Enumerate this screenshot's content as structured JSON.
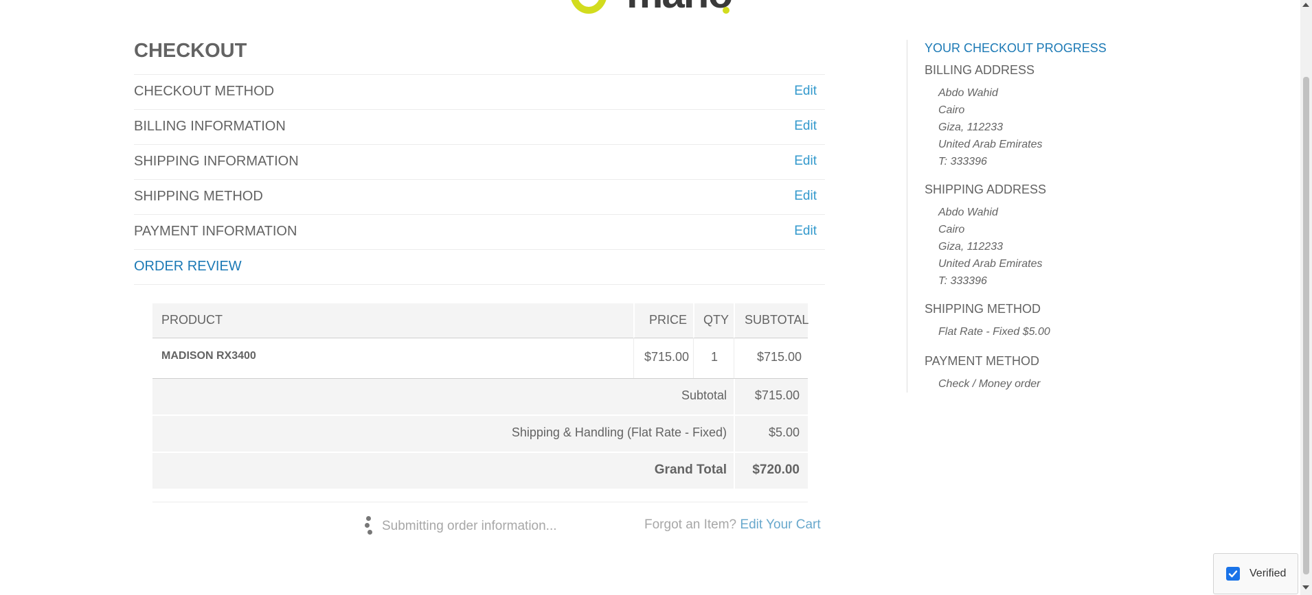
{
  "page": {
    "title": "CHECKOUT",
    "steps": [
      {
        "label": "CHECKOUT METHOD",
        "edit": "Edit"
      },
      {
        "label": "BILLING INFORMATION",
        "edit": "Edit"
      },
      {
        "label": "SHIPPING INFORMATION",
        "edit": "Edit"
      },
      {
        "label": "SHIPPING METHOD",
        "edit": "Edit"
      },
      {
        "label": "PAYMENT INFORMATION",
        "edit": "Edit"
      },
      {
        "label": "ORDER REVIEW",
        "edit": ""
      }
    ]
  },
  "review": {
    "headers": {
      "product": "PRODUCT",
      "price": "PRICE",
      "qty": "QTY",
      "subtotal": "SUBTOTAL"
    },
    "items": [
      {
        "name": "MADISON RX3400",
        "price": "$715.00",
        "qty": "1",
        "subtotal": "$715.00"
      }
    ],
    "totals": {
      "subtotal_label": "Subtotal",
      "subtotal": "$715.00",
      "shipping_label": "Shipping & Handling (Flat Rate - Fixed)",
      "shipping": "$5.00",
      "grand_label": "Grand Total",
      "grand": "$720.00"
    },
    "status": "Submitting order information...",
    "forgot": "Forgot an Item?",
    "edit_cart": "Edit Your Cart"
  },
  "progress": {
    "title": "YOUR CHECKOUT PROGRESS",
    "billing": {
      "heading": "BILLING ADDRESS",
      "lines": [
        "Abdo Wahid",
        "Cairo",
        "Giza, 112233",
        "United Arab Emirates",
        "T: 333396"
      ]
    },
    "shipping": {
      "heading": "SHIPPING ADDRESS",
      "lines": [
        "Abdo Wahid",
        "Cairo",
        "Giza, 112233",
        "United Arab Emirates",
        "T: 333396"
      ]
    },
    "shipping_method": {
      "heading": "SHIPPING METHOD",
      "value": "Flat Rate - Fixed $5.00"
    },
    "payment_method": {
      "heading": "PAYMENT METHOD",
      "value": "Check / Money order"
    }
  },
  "recaptcha": {
    "label": "Verified",
    "icon": "checkbox-checked-icon"
  },
  "colors": {
    "accent": "#1b79b5",
    "link": "#3399cc",
    "brand": "#d2dc1e"
  }
}
